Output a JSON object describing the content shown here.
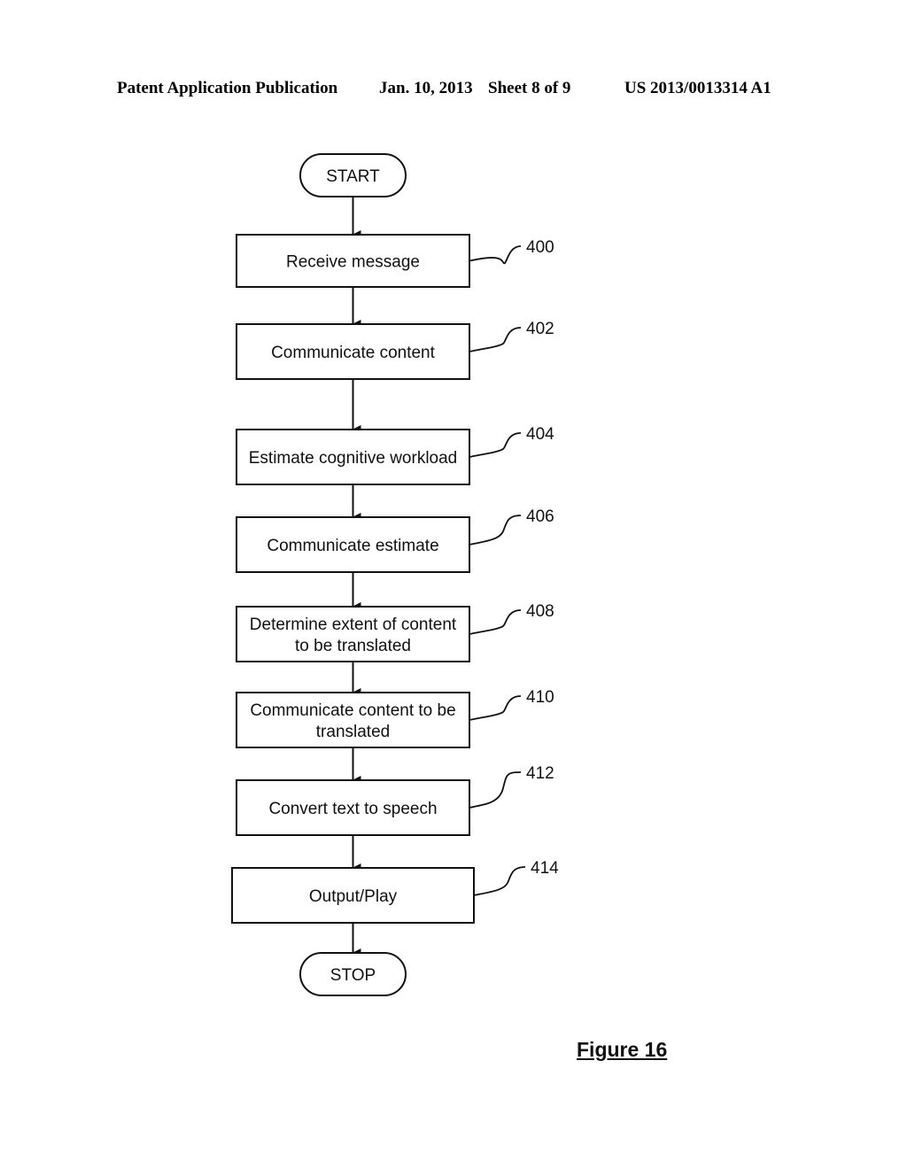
{
  "header": {
    "publication": "Patent Application Publication",
    "date": "Jan. 10, 2013",
    "sheet": "Sheet 8 of 9",
    "number": "US 2013/0013314 A1"
  },
  "flowchart": {
    "start": "START",
    "stop": "STOP",
    "steps": [
      {
        "ref": "400",
        "lines": [
          "Receive message"
        ]
      },
      {
        "ref": "402",
        "lines": [
          "Communicate content"
        ]
      },
      {
        "ref": "404",
        "lines": [
          "Estimate cognitive workload"
        ]
      },
      {
        "ref": "406",
        "lines": [
          "Communicate estimate"
        ]
      },
      {
        "ref": "408",
        "lines": [
          "Determine extent of content",
          "to be translated"
        ]
      },
      {
        "ref": "410",
        "lines": [
          "Communicate content to be",
          "translated"
        ]
      },
      {
        "ref": "412",
        "lines": [
          "Convert text to speech"
        ]
      },
      {
        "ref": "414",
        "lines": [
          "Output/Play"
        ]
      }
    ]
  },
  "figure_caption": "Figure 16"
}
